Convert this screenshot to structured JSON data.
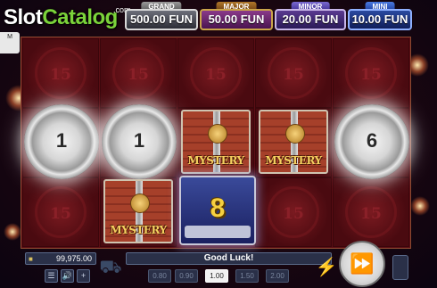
{
  "logo": {
    "prefix": "Slot",
    "highlight": "Catalog",
    "suffix": ".com",
    "side_tab": "M"
  },
  "jackpots": [
    {
      "label": "GRAND",
      "value": "500.00 FUN"
    },
    {
      "label": "MAJOR",
      "value": "50.00 FUN"
    },
    {
      "label": "MINOR",
      "value": "20.00 FUN"
    },
    {
      "label": "MINI",
      "value": "10.00 FUN"
    }
  ],
  "reels": {
    "empty_value": "15",
    "coins": [
      "1",
      "1",
      "6"
    ],
    "mystery_label": "MYSTERY",
    "chest_value": "8"
  },
  "footer": {
    "balance": "99,975.00",
    "message": "Good Luck!",
    "bets": [
      "0.80",
      "0.90",
      "1.00",
      "1.50",
      "2.00"
    ],
    "selected_bet": "1.00",
    "spin_symbol": "⏩",
    "menu_symbol": "☰",
    "sound_symbol": "🔊",
    "plus_symbol": "+"
  },
  "colors": {
    "background": "#1a0610",
    "reel_bg": "#5a0d14",
    "mystery_text": "#f4d060"
  }
}
